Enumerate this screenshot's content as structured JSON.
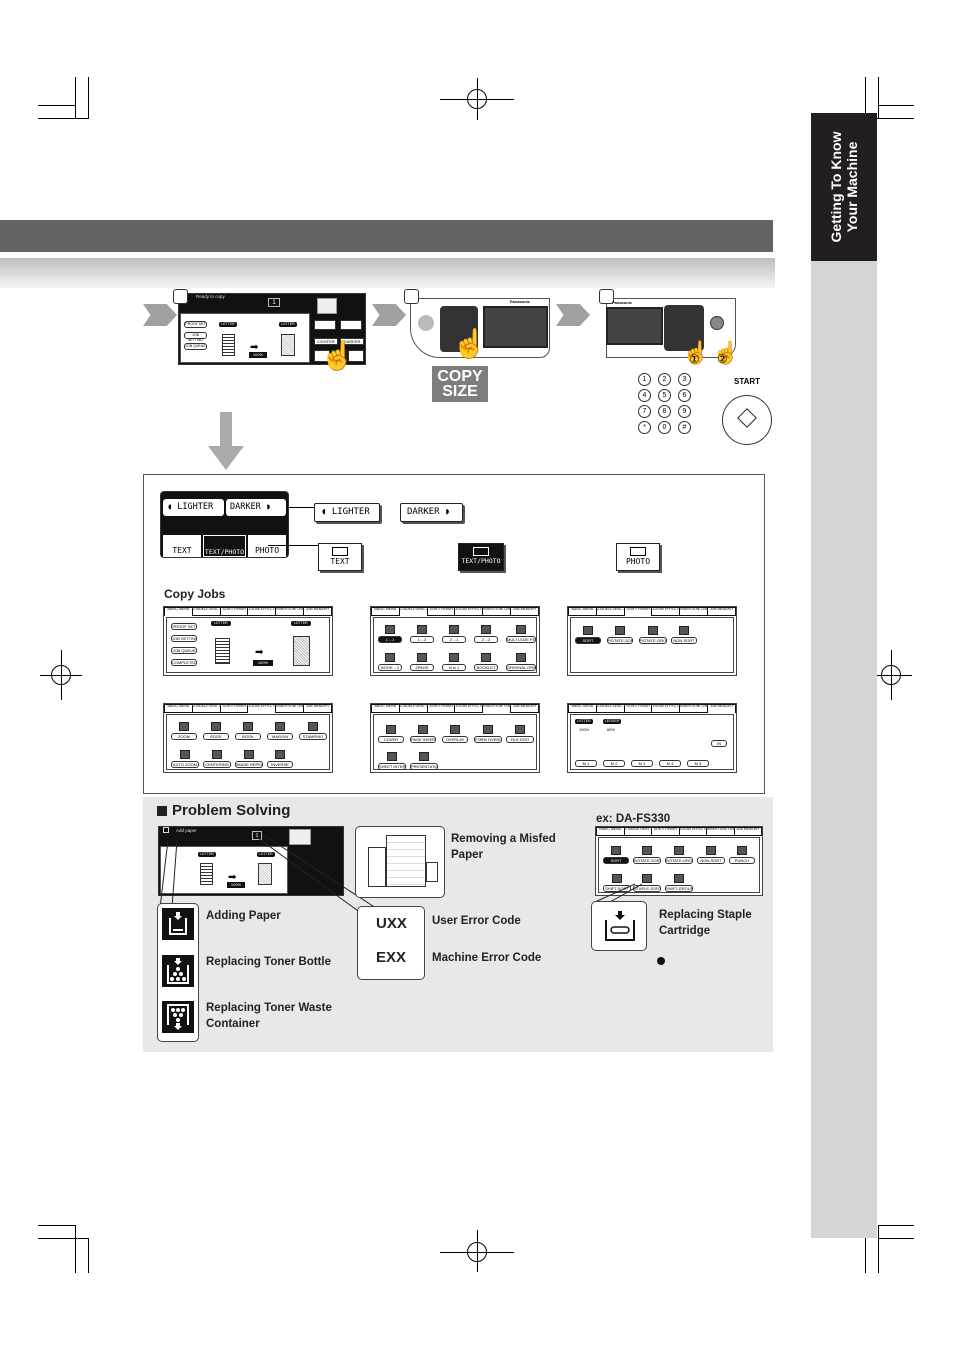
{
  "side_tab": {
    "line1": "Getting To Know",
    "line2": "Your Machine"
  },
  "steps": {
    "step1": {
      "status_text": "Ready to copy",
      "count": "1",
      "tabs": [
        "BASIC MENU",
        "2-SIDED/ ORIG→COPY",
        "SORT/ FINISH",
        "ZOOM/ EFFECTS",
        "INSERTION/ OVERLAY",
        "JOB MEMORY"
      ],
      "side_buttons": [
        "PROOF SET",
        "JOB SETTING",
        "JOB QUEUE",
        "COMPLETED JOB LIST"
      ],
      "orig_size": "LETTER",
      "copy_size": "LETTER",
      "zoom": "100%",
      "paper_label": "LETTER",
      "auto_label": "AUTO",
      "lighter": "LIGHTER",
      "darker": "DARKER",
      "modes": [
        "TEXT",
        "TEXT/PHOTO",
        "PHOTO"
      ]
    },
    "step2": {
      "brand": "Panasonic",
      "key_label": "COPY SIZE"
    },
    "step3": {
      "brand": "Panasonic",
      "callout1": "①",
      "callout2": "②",
      "keypad": [
        "1",
        "2",
        "3",
        "4",
        "5",
        "6",
        "7",
        "8",
        "9",
        "*",
        "0",
        "#"
      ],
      "start_label": "START"
    }
  },
  "density": {
    "lighter_label": "LIGHTER",
    "darker_label": "DARKER",
    "modes": [
      {
        "label": "TEXT",
        "selected": false
      },
      {
        "label": "TEXT/PHOTO",
        "selected": true
      },
      {
        "label": "PHOTO",
        "selected": false
      }
    ]
  },
  "copy_jobs": {
    "heading": "Copy Jobs",
    "tabs": [
      "BASIC MENU",
      "2-SIDED/ ORIG→COPY",
      "SORT/ FINISH",
      "ZOOM/ EFFECTS",
      "INSERTION/ OVERLAY",
      "JOB MEMORY"
    ],
    "screens": [
      {
        "name": "basic-menu",
        "selected_tab": 0,
        "buttons": [
          "PROOF SET",
          "JOB SETTING",
          "JOB QUEUE",
          "COMPLETED JOB LIST"
        ],
        "orig": "LETTER",
        "copy": "LETTER",
        "zoom": "100%"
      },
      {
        "name": "two-sided",
        "selected_tab": 1,
        "buttons": [
          "1→1",
          "1→2",
          "2→1",
          "2→2",
          "MULTI-SIZE FEED",
          "BOOK→2",
          "2PAGE",
          "N in 1",
          "BOOKLET",
          "ORIGINAL ORIENTATION"
        ]
      },
      {
        "name": "sort-finish",
        "selected_tab": 2,
        "buttons": [
          "SORT",
          "ROTATE-SORT",
          "ROTATE-GROUP",
          "NON-SORT"
        ]
      },
      {
        "name": "zoom-effects",
        "selected_tab": 3,
        "buttons": [
          "ZOOM",
          "EDGE",
          "BOOK",
          "MARGIN",
          "STAMPING",
          "AUTO ZOOM",
          "CENTERING",
          "IMAGE REPEAT",
          "INVERSE"
        ]
      },
      {
        "name": "insertion-overlay",
        "selected_tab": 4,
        "buttons": [
          "COVER",
          "PAGE INSERTION",
          "OVERLAY",
          "FORM OVERLAY",
          "FILE EDIT",
          "SHEET INTERLEAVING",
          "PRESENTATION"
        ]
      },
      {
        "name": "job-memory",
        "selected_tab": 5,
        "buttons": [
          "M 1",
          "M 2",
          "M 3",
          "M 4",
          "M 5",
          "IN"
        ],
        "slots": [
          {
            "paper": "LETTER",
            "zoom": "100%"
          },
          {
            "paper": "LEDGER",
            "zoom": "65%"
          }
        ]
      }
    ]
  },
  "problem_solving": {
    "heading": "Problem Solving",
    "screen_status": "Add paper",
    "items": [
      {
        "label": "Adding Paper",
        "icon": "add-paper-icon"
      },
      {
        "label": "Replacing Toner Bottle",
        "icon": "toner-bottle-icon"
      },
      {
        "label": "Replacing Toner Waste Container",
        "icon": "toner-waste-icon"
      }
    ],
    "misfed_label": "Removing a Misfed Paper",
    "error_codes": [
      {
        "code": "UXX",
        "label": "User Error Code"
      },
      {
        "code": "EXX",
        "label": "Machine Error Code"
      }
    ],
    "finisher": {
      "title": "ex: DA-FS330",
      "buttons": [
        "SORT",
        "ROTATE-SORT",
        "ROTATE-GROUP",
        "NON-SORT",
        "PUNCH",
        "SHIFT-SORT",
        "STAPLE-SORT",
        "SHIFT-GROUP"
      ],
      "staple_label": "Replacing Staple Cartridge"
    }
  }
}
